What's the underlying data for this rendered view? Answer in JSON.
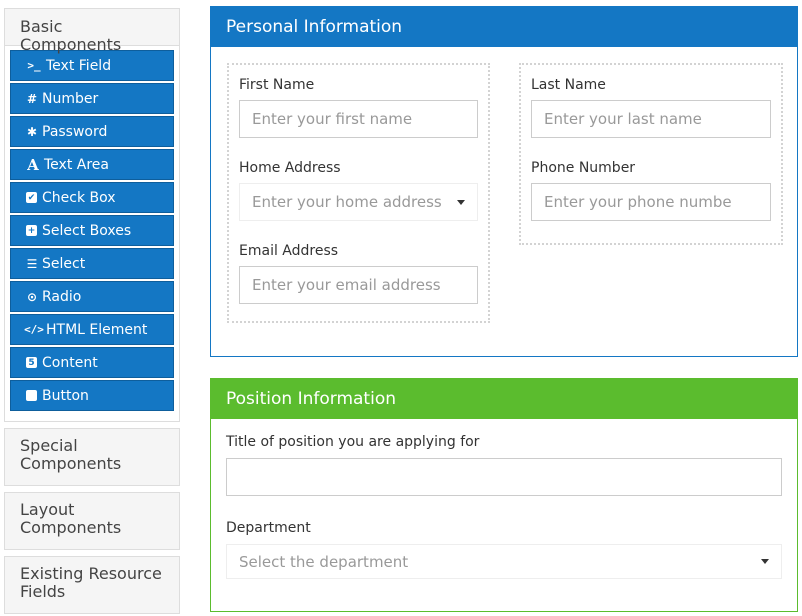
{
  "sidebar": {
    "basic": {
      "title": "Basic Components",
      "items": [
        {
          "label": "Text Field",
          "icon": "terminal-icon"
        },
        {
          "label": "Number",
          "icon": "hash-icon"
        },
        {
          "label": "Password",
          "icon": "asterisk-icon"
        },
        {
          "label": "Text Area",
          "icon": "font-icon"
        },
        {
          "label": "Check Box",
          "icon": "checkbox-icon"
        },
        {
          "label": "Select Boxes",
          "icon": "plus-square-icon"
        },
        {
          "label": "Select",
          "icon": "list-icon"
        },
        {
          "label": "Radio",
          "icon": "radio-icon"
        },
        {
          "label": "HTML Element",
          "icon": "code-icon"
        },
        {
          "label": "Content",
          "icon": "html5-icon"
        },
        {
          "label": "Button",
          "icon": "stop-icon"
        }
      ]
    },
    "special": {
      "title": "Special Components"
    },
    "layout": {
      "title": "Layout Components"
    },
    "existing": {
      "title": "Existing Resource Fields"
    }
  },
  "personal": {
    "title": "Personal Information",
    "first_name": {
      "label": "First Name",
      "placeholder": "Enter your first name"
    },
    "last_name": {
      "label": "Last Name",
      "placeholder": "Enter your last name"
    },
    "home_address": {
      "label": "Home Address",
      "placeholder": "Enter your home address"
    },
    "phone": {
      "label": "Phone Number",
      "placeholder": "Enter your phone numbe"
    },
    "email": {
      "label": "Email Address",
      "placeholder": "Enter your email address"
    }
  },
  "position": {
    "title": "Position Information",
    "title_field": {
      "label": "Title of position you are applying for",
      "value": ""
    },
    "department": {
      "label": "Department",
      "placeholder": "Select the department"
    }
  },
  "colors": {
    "primary": "#1477c4",
    "success": "#5bbc2e"
  }
}
